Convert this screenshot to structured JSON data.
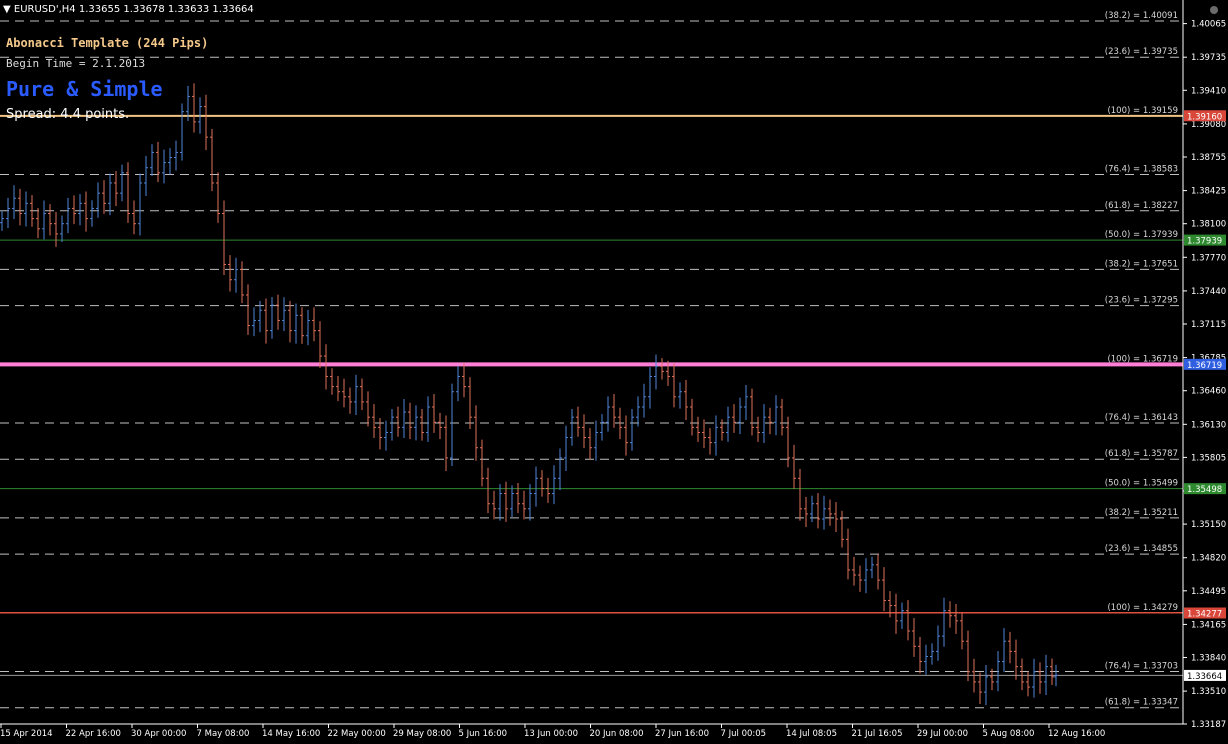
{
  "window": {
    "symbol_line": "EURUSD',H4  1.33655 1.33678 1.33633 1.33664"
  },
  "overlay": {
    "template": "Abonacci Template (244 Pips)",
    "begin_time": "Begin Time = 2.1.2013",
    "brand": "Pure & Simple",
    "spread": "Spread: 4.4 points."
  },
  "colors": {
    "background": "#000000",
    "bull": "#4f86d9",
    "bear": "#e0725a",
    "grid_dashed": "#bfbfbf",
    "level_orange": "#f2c484",
    "level_green": "#2f8a2f",
    "level_pink": "#ff7fd6",
    "level_red": "#e0503e",
    "tag_red": "#d8473a",
    "tag_green": "#2f8a2f",
    "tag_blue": "#2f5fe0",
    "tag_white": "#ffffff"
  },
  "chart_data": {
    "type": "candlestick",
    "symbol": "EURUSD'",
    "timeframe": "H4",
    "ylim": [
      1.33187,
      1.4012
    ],
    "y_ticks": [
      "1.40065",
      "1.39735",
      "1.39410",
      "1.39080",
      "1.38755",
      "1.38425",
      "1.38100",
      "1.37770",
      "1.37440",
      "1.37115",
      "1.36785",
      "1.36460",
      "1.36130",
      "1.35805",
      "1.35475",
      "1.35150",
      "1.34820",
      "1.34495",
      "1.34165",
      "1.33840",
      "1.33510",
      "1.33187"
    ],
    "x_ticks": [
      "15 Apr 2014",
      "22 Apr 16:00",
      "30 Apr 00:00",
      "7 May 08:00",
      "14 May 16:00",
      "22 May 00:00",
      "29 May 08:00",
      "5 Jun 16:00",
      "13 Jun 00:00",
      "20 Jun 08:00",
      "27 Jun 16:00",
      "7 Jul 00:05",
      "14 Jul 08:05",
      "21 Jul 16:05",
      "29 Jul 00:00",
      "5 Aug 08:00",
      "12 Aug 16:00"
    ],
    "levels": [
      {
        "label": "(38.2) = 1.40091",
        "value": 1.40091,
        "style": "dashed"
      },
      {
        "label": "(23.6) = 1.39735",
        "value": 1.39735,
        "style": "dashed"
      },
      {
        "label": "(100) = 1.39159",
        "value": 1.39159,
        "style": "solid-orange"
      },
      {
        "label": "(76.4) = 1.38583",
        "value": 1.38583,
        "style": "dashed"
      },
      {
        "label": "(61.8) = 1.38227",
        "value": 1.38227,
        "style": "dashed"
      },
      {
        "label": "(50.0) = 1.37939",
        "value": 1.37939,
        "style": "solid-green"
      },
      {
        "label": "(38.2) = 1.37651",
        "value": 1.37651,
        "style": "dashed"
      },
      {
        "label": "(23.6) = 1.37295",
        "value": 1.37295,
        "style": "dashed"
      },
      {
        "label": "(100) = 1.36719",
        "value": 1.36719,
        "style": "solid-pink"
      },
      {
        "label": "(76.4) = 1.36143",
        "value": 1.36143,
        "style": "dashed"
      },
      {
        "label": "(61.8) = 1.35787",
        "value": 1.35787,
        "style": "dashed"
      },
      {
        "label": "(50.0) = 1.35499",
        "value": 1.35499,
        "style": "solid-green"
      },
      {
        "label": "(38.2) = 1.35211",
        "value": 1.35211,
        "style": "dashed"
      },
      {
        "label": "(23.6) = 1.34855",
        "value": 1.34855,
        "style": "dashed"
      },
      {
        "label": "(100) = 1.34279",
        "value": 1.34279,
        "style": "solid-red"
      },
      {
        "label": "(76.4) = 1.33703",
        "value": 1.33703,
        "style": "dashed"
      },
      {
        "label": "(61.8) = 1.33347",
        "value": 1.33347,
        "style": "dashed"
      }
    ],
    "price_tags": [
      {
        "text": "1.39160",
        "value": 1.3916,
        "color": "tag_red"
      },
      {
        "text": "1.37939",
        "value": 1.37939,
        "color": "tag_green"
      },
      {
        "text": "1.36719",
        "value": 1.36719,
        "color": "tag_blue"
      },
      {
        "text": "1.35498",
        "value": 1.35498,
        "color": "tag_green"
      },
      {
        "text": "1.34277",
        "value": 1.34277,
        "color": "tag_red"
      },
      {
        "text": "1.33664",
        "value": 1.33664,
        "color": "tag_white"
      }
    ],
    "current_price": 1.33664,
    "bars": [
      [
        0,
        1.3815
      ],
      [
        6,
        1.3825
      ],
      [
        12,
        1.3835
      ],
      [
        18,
        1.382
      ],
      [
        24,
        1.383
      ],
      [
        30,
        1.3815
      ],
      [
        36,
        1.3805
      ],
      [
        42,
        1.382
      ],
      [
        48,
        1.381
      ],
      [
        54,
        1.38
      ],
      [
        60,
        1.381
      ],
      [
        66,
        1.3825
      ],
      [
        72,
        1.382
      ],
      [
        78,
        1.383
      ],
      [
        84,
        1.3815
      ],
      [
        90,
        1.3825
      ],
      [
        96,
        1.384
      ],
      [
        102,
        1.383
      ],
      [
        108,
        1.385
      ],
      [
        114,
        1.384
      ],
      [
        120,
        1.386
      ],
      [
        126,
        1.382
      ],
      [
        132,
        1.381
      ],
      [
        138,
        1.385
      ],
      [
        144,
        1.3865
      ],
      [
        150,
        1.388
      ],
      [
        156,
        1.386
      ],
      [
        162,
        1.387
      ],
      [
        168,
        1.3875
      ],
      [
        174,
        1.388
      ],
      [
        180,
        1.392
      ],
      [
        186,
        1.3935
      ],
      [
        192,
        1.391
      ],
      [
        198,
        1.3925
      ],
      [
        204,
        1.3895
      ],
      [
        210,
        1.385
      ],
      [
        216,
        1.382
      ],
      [
        222,
        1.377
      ],
      [
        228,
        1.3755
      ],
      [
        234,
        1.3765
      ],
      [
        240,
        1.374
      ],
      [
        246,
        1.371
      ],
      [
        252,
        1.3715
      ],
      [
        258,
        1.3725
      ],
      [
        264,
        1.3705
      ],
      [
        270,
        1.373
      ],
      [
        276,
        1.3715
      ],
      [
        282,
        1.3725
      ],
      [
        288,
        1.3705
      ],
      [
        294,
        1.372
      ],
      [
        300,
        1.37
      ],
      [
        306,
        1.3715
      ],
      [
        312,
        1.3705
      ],
      [
        318,
        1.368
      ],
      [
        324,
        1.366
      ],
      [
        330,
        1.365
      ],
      [
        336,
        1.3645
      ],
      [
        342,
        1.364
      ],
      [
        348,
        1.3635
      ],
      [
        354,
        1.365
      ],
      [
        360,
        1.3635
      ],
      [
        366,
        1.362
      ],
      [
        372,
        1.361
      ],
      [
        378,
        1.36
      ],
      [
        384,
        1.3605
      ],
      [
        390,
        1.362
      ],
      [
        396,
        1.361
      ],
      [
        402,
        1.3625
      ],
      [
        408,
        1.361
      ],
      [
        414,
        1.362
      ],
      [
        420,
        1.3605
      ],
      [
        426,
        1.363
      ],
      [
        432,
        1.3615
      ],
      [
        438,
        1.361
      ],
      [
        444,
        1.358
      ],
      [
        450,
        1.3645
      ],
      [
        456,
        1.366
      ],
      [
        462,
        1.365
      ],
      [
        468,
        1.362
      ],
      [
        474,
        1.359
      ],
      [
        480,
        1.356
      ],
      [
        486,
        1.3535
      ],
      [
        492,
        1.353
      ],
      [
        498,
        1.3545
      ],
      [
        504,
        1.353
      ],
      [
        510,
        1.3545
      ],
      [
        516,
        1.3535
      ],
      [
        522,
        1.353
      ],
      [
        528,
        1.3545
      ],
      [
        534,
        1.356
      ],
      [
        540,
        1.355
      ],
      [
        546,
        1.3545
      ],
      [
        552,
        1.356
      ],
      [
        558,
        1.358
      ],
      [
        564,
        1.36
      ],
      [
        570,
        1.362
      ],
      [
        576,
        1.361
      ],
      [
        582,
        1.36
      ],
      [
        588,
        1.359
      ],
      [
        594,
        1.3605
      ],
      [
        600,
        1.3615
      ],
      [
        606,
        1.363
      ],
      [
        612,
        1.362
      ],
      [
        618,
        1.361
      ],
      [
        624,
        1.3595
      ],
      [
        630,
        1.362
      ],
      [
        636,
        1.363
      ],
      [
        642,
        1.364
      ],
      [
        648,
        1.366
      ],
      [
        654,
        1.367
      ],
      [
        660,
        1.3665
      ],
      [
        666,
        1.366
      ],
      [
        672,
        1.364
      ],
      [
        678,
        1.3645
      ],
      [
        684,
        1.363
      ],
      [
        690,
        1.361
      ],
      [
        696,
        1.3605
      ],
      [
        702,
        1.36
      ],
      [
        708,
        1.3595
      ],
      [
        714,
        1.361
      ],
      [
        720,
        1.3605
      ],
      [
        726,
        1.362
      ],
      [
        732,
        1.3615
      ],
      [
        738,
        1.363
      ],
      [
        744,
        1.364
      ],
      [
        750,
        1.361
      ],
      [
        756,
        1.3605
      ],
      [
        762,
        1.362
      ],
      [
        768,
        1.3615
      ],
      [
        774,
        1.363
      ],
      [
        780,
        1.361
      ],
      [
        786,
        1.358
      ],
      [
        792,
        1.356
      ],
      [
        798,
        1.353
      ],
      [
        804,
        1.3525
      ],
      [
        810,
        1.3535
      ],
      [
        816,
        1.352
      ],
      [
        822,
        1.353
      ],
      [
        828,
        1.3525
      ],
      [
        834,
        1.352
      ],
      [
        840,
        1.35
      ],
      [
        846,
        1.347
      ],
      [
        852,
        1.3465
      ],
      [
        858,
        1.346
      ],
      [
        864,
        1.347
      ],
      [
        870,
        1.3475
      ],
      [
        876,
        1.346
      ],
      [
        882,
        1.344
      ],
      [
        888,
        1.3435
      ],
      [
        894,
        1.342
      ],
      [
        900,
        1.343
      ],
      [
        906,
        1.341
      ],
      [
        912,
        1.3395
      ],
      [
        918,
        1.338
      ],
      [
        924,
        1.3385
      ],
      [
        930,
        1.339
      ],
      [
        936,
        1.3405
      ],
      [
        942,
        1.343
      ],
      [
        948,
        1.3425
      ],
      [
        954,
        1.342
      ],
      [
        960,
        1.34
      ],
      [
        966,
        1.337
      ],
      [
        972,
        1.336
      ],
      [
        978,
        1.335
      ],
      [
        984,
        1.3365
      ],
      [
        990,
        1.336
      ],
      [
        996,
        1.338
      ],
      [
        1002,
        1.34
      ],
      [
        1008,
        1.339
      ],
      [
        1014,
        1.3375
      ],
      [
        1020,
        1.336
      ],
      [
        1026,
        1.3355
      ],
      [
        1032,
        1.337
      ],
      [
        1038,
        1.336
      ],
      [
        1044,
        1.3375
      ],
      [
        1050,
        1.3365
      ],
      [
        1054,
        1.33664
      ]
    ]
  }
}
